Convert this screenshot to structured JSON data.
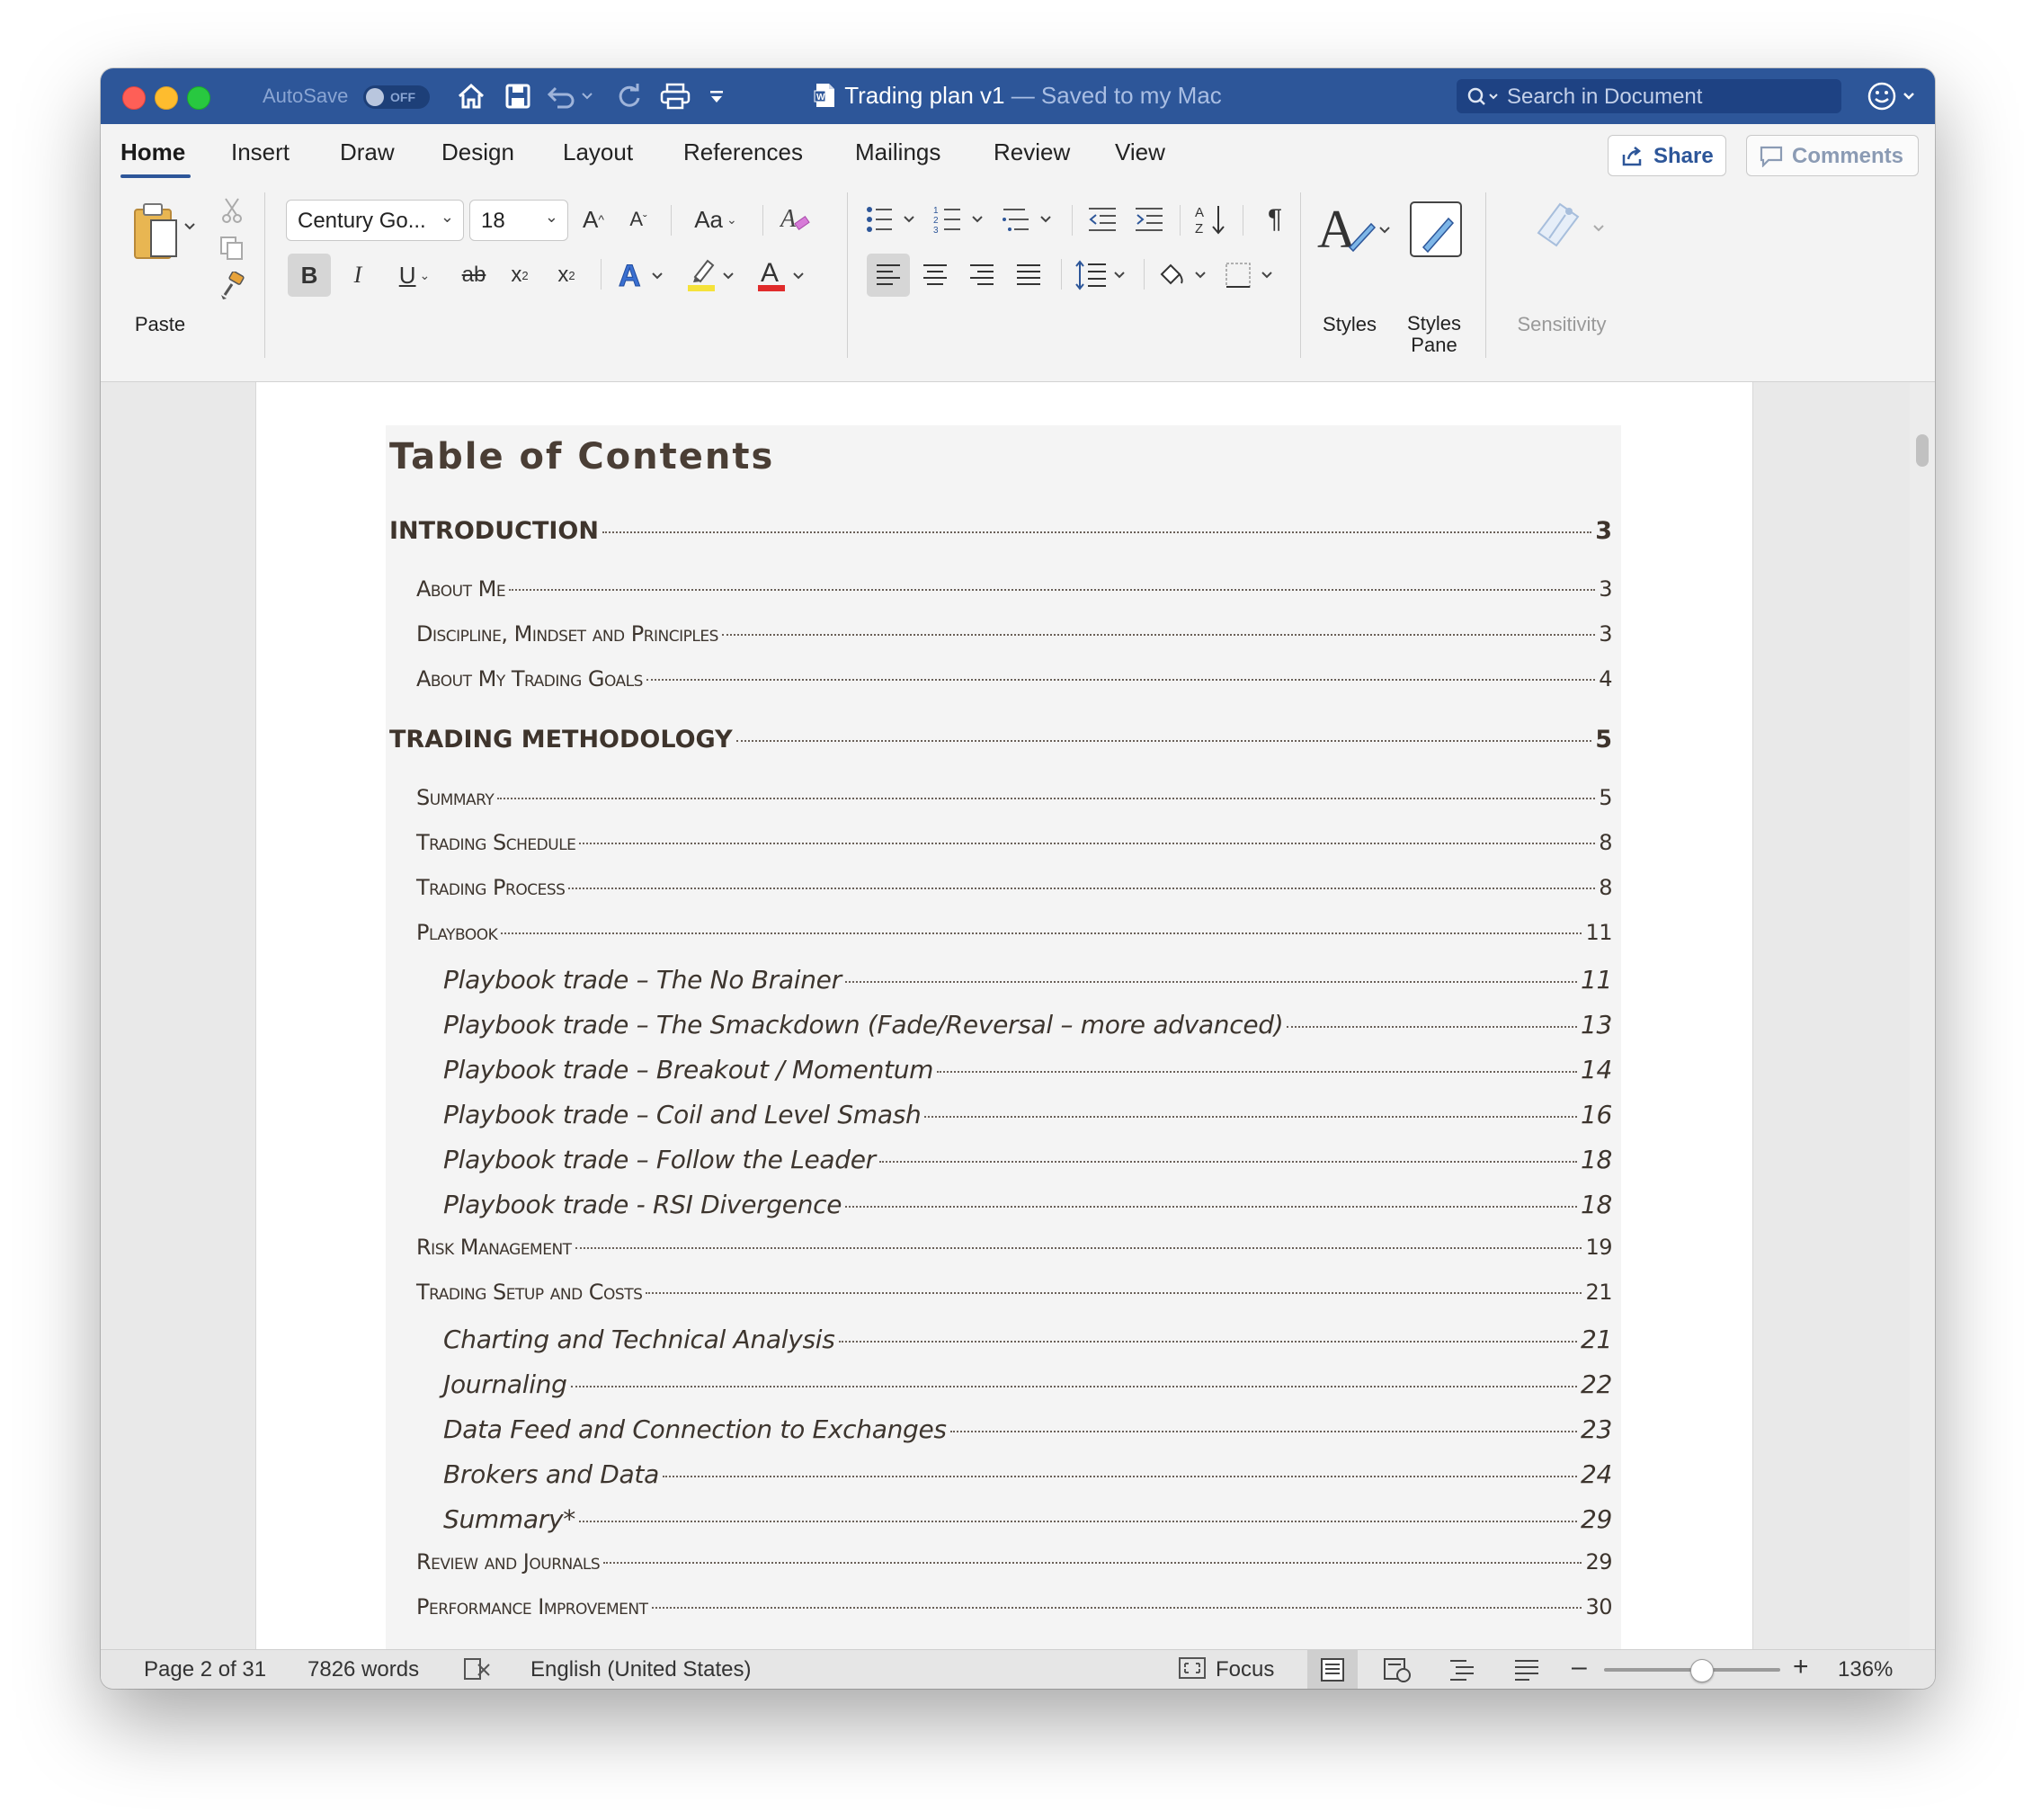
{
  "window": {
    "title": "Trading plan v1",
    "title_status": "— Saved to my Mac",
    "autosave_label": "AutoSave",
    "autosave_state": "OFF",
    "search_placeholder": "Search in Document"
  },
  "tabs": [
    "Home",
    "Insert",
    "Draw",
    "Design",
    "Layout",
    "References",
    "Mailings",
    "Review",
    "View"
  ],
  "active_tab": "Home",
  "share_label": "Share",
  "comments_label": "Comments",
  "ribbon": {
    "paste_label": "Paste",
    "font_name": "Century Go...",
    "font_size": "18",
    "change_case": "Aa",
    "styles_label": "Styles",
    "styles_pane_label": "Styles Pane",
    "sensitivity_label": "Sensitivity",
    "highlight_color": "#f5e23a",
    "font_color": "#e02b2b"
  },
  "toc": {
    "title": "Table of Contents",
    "entries": [
      {
        "level": 1,
        "text": "INTRODUCTION",
        "page": "3"
      },
      {
        "level": 2,
        "text": "About Me",
        "page": "3"
      },
      {
        "level": 2,
        "text": "Discipline, Mindset and Principles",
        "page": "3"
      },
      {
        "level": 2,
        "text": "About My Trading Goals",
        "page": "4"
      },
      {
        "level": 1,
        "text": "TRADING METHODOLOGY",
        "page": "5"
      },
      {
        "level": 2,
        "text": "Summary",
        "page": "5"
      },
      {
        "level": 2,
        "text": "Trading Schedule",
        "page": "8"
      },
      {
        "level": 2,
        "text": "Trading Process",
        "page": "8"
      },
      {
        "level": 2,
        "text": "Playbook",
        "page": "11"
      },
      {
        "level": 3,
        "text": "Playbook trade – The No Brainer",
        "page": "11"
      },
      {
        "level": 3,
        "text": "Playbook trade – The Smackdown (Fade/Reversal – more advanced)",
        "page": "13"
      },
      {
        "level": 3,
        "text": "Playbook trade – Breakout / Momentum",
        "page": "14"
      },
      {
        "level": 3,
        "text": "Playbook trade – Coil and Level Smash",
        "page": "16"
      },
      {
        "level": 3,
        "text": "Playbook trade – Follow the Leader",
        "page": "18"
      },
      {
        "level": 3,
        "text": "Playbook trade - RSI Divergence",
        "page": "18"
      },
      {
        "level": 2,
        "text": "Risk Management",
        "page": "19"
      },
      {
        "level": 2,
        "text": "Trading Setup and Costs",
        "page": "21"
      },
      {
        "level": 3,
        "text": "Charting and Technical Analysis",
        "page": "21"
      },
      {
        "level": 3,
        "text": "Journaling",
        "page": "22"
      },
      {
        "level": 3,
        "text": "Data Feed and Connection to Exchanges",
        "page": "23"
      },
      {
        "level": 3,
        "text": "Brokers and Data",
        "page": "24"
      },
      {
        "level": 3,
        "text": "Summary*",
        "page": "29"
      },
      {
        "level": 2,
        "text": "Review and Journals",
        "page": "29"
      },
      {
        "level": 2,
        "text": "Performance Improvement",
        "page": "30"
      }
    ]
  },
  "status": {
    "page": "Page 2 of 31",
    "words": "7826 words",
    "language": "English (United States)",
    "focus": "Focus",
    "zoom": "136%",
    "zoom_fraction": 0.55
  }
}
